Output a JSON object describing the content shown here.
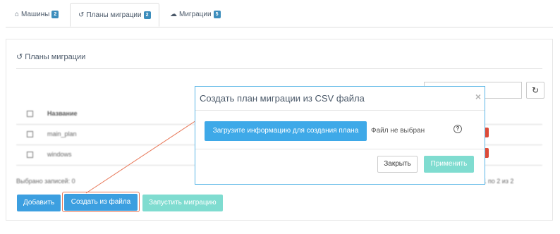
{
  "tabs": [
    {
      "label": "Машины",
      "badge": "2",
      "icon": "home-icon"
    },
    {
      "label": "Планы миграции",
      "badge": "2",
      "icon": "history-icon"
    },
    {
      "label": "Миграции",
      "badge": "5",
      "icon": "cloud-icon"
    }
  ],
  "panel": {
    "title": "Планы миграции",
    "table": {
      "header": "Название",
      "rows": [
        "main_plan",
        "windows"
      ]
    },
    "selected_count": "Выбрано записей: 0",
    "pagination": "Записи с 1 по 2 из 2"
  },
  "actions": {
    "add": "Добавить",
    "create_from_file": "Создать из файла",
    "start_migration": "Запустить миграцию"
  },
  "modal": {
    "title": "Создать план миграции из CSV файла",
    "close_glyph": "×",
    "upload_button": "Загрузите информацию для создания плана",
    "file_status": "Файл не выбран",
    "help_glyph": "?",
    "close_button": "Закрыть",
    "apply_button": "Применить"
  },
  "colors": {
    "primary": "#3c9fe0",
    "teal_disabled": "#7fdcd0",
    "badge": "#3c8dbc",
    "highlight": "#e8795a",
    "danger": "#dd4b39"
  }
}
